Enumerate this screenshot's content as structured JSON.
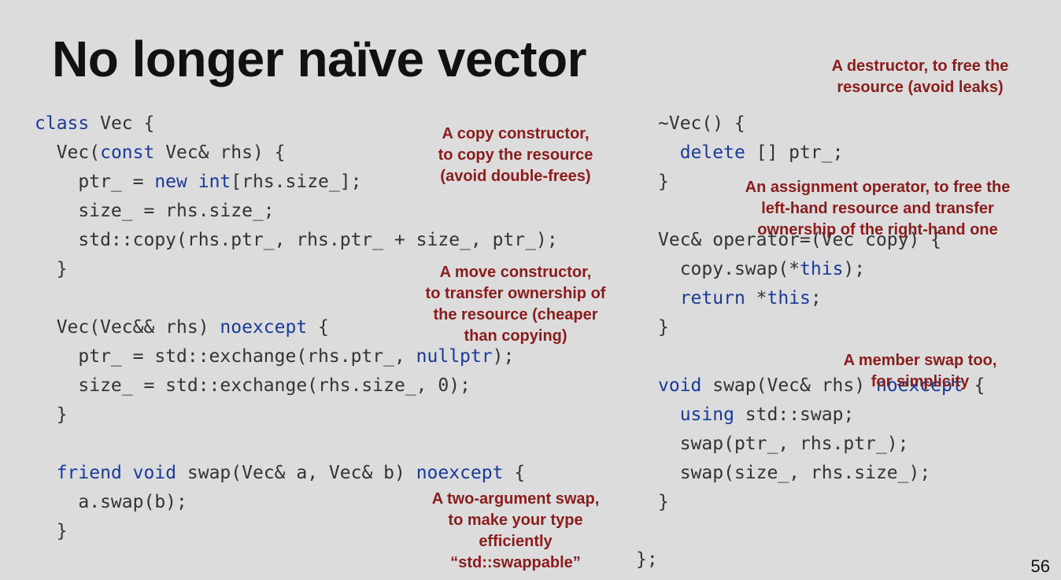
{
  "slide": {
    "title": "No longer naïve vector",
    "page_number": "56"
  },
  "code_left": [
    {
      "indent": 0,
      "tokens": [
        {
          "t": "class",
          "k": true
        },
        {
          "t": " Vec {"
        }
      ]
    },
    {
      "indent": 1,
      "tokens": [
        {
          "t": "Vec("
        },
        {
          "t": "const",
          "k": true
        },
        {
          "t": " Vec& rhs) {"
        }
      ]
    },
    {
      "indent": 2,
      "tokens": [
        {
          "t": "ptr_ = "
        },
        {
          "t": "new",
          "k": true
        },
        {
          "t": " "
        },
        {
          "t": "int",
          "k": true
        },
        {
          "t": "[rhs.size_];"
        }
      ]
    },
    {
      "indent": 2,
      "tokens": [
        {
          "t": "size_ = rhs.size_;"
        }
      ]
    },
    {
      "indent": 2,
      "tokens": [
        {
          "t": "std::copy(rhs.ptr_, rhs.ptr_ + size_, ptr_);"
        }
      ]
    },
    {
      "indent": 1,
      "tokens": [
        {
          "t": "}"
        }
      ]
    },
    {
      "indent": 0,
      "tokens": []
    },
    {
      "indent": 1,
      "tokens": [
        {
          "t": "Vec(Vec&& rhs) "
        },
        {
          "t": "noexcept",
          "k": true
        },
        {
          "t": " {"
        }
      ]
    },
    {
      "indent": 2,
      "tokens": [
        {
          "t": "ptr_ = std::exchange(rhs.ptr_, "
        },
        {
          "t": "nullptr",
          "k": true
        },
        {
          "t": ");"
        }
      ]
    },
    {
      "indent": 2,
      "tokens": [
        {
          "t": "size_ = std::exchange(rhs.size_, 0);"
        }
      ]
    },
    {
      "indent": 1,
      "tokens": [
        {
          "t": "}"
        }
      ]
    },
    {
      "indent": 0,
      "tokens": []
    },
    {
      "indent": 1,
      "tokens": [
        {
          "t": "friend",
          "k": true
        },
        {
          "t": " "
        },
        {
          "t": "void",
          "k": true
        },
        {
          "t": " swap(Vec& a, Vec& b) "
        },
        {
          "t": "noexcept",
          "k": true
        },
        {
          "t": " {"
        }
      ]
    },
    {
      "indent": 2,
      "tokens": [
        {
          "t": "a.swap(b);"
        }
      ]
    },
    {
      "indent": 1,
      "tokens": [
        {
          "t": "}"
        }
      ]
    }
  ],
  "code_right": [
    {
      "indent": 0,
      "tokens": [
        {
          "t": "~Vec() {"
        }
      ]
    },
    {
      "indent": 1,
      "tokens": [
        {
          "t": "delete",
          "k": true
        },
        {
          "t": " [] ptr_;"
        }
      ]
    },
    {
      "indent": 0,
      "tokens": [
        {
          "t": "}"
        }
      ]
    },
    {
      "indent": 0,
      "tokens": []
    },
    {
      "indent": 0,
      "tokens": [
        {
          "t": "Vec& operator=(Vec copy) {"
        }
      ]
    },
    {
      "indent": 1,
      "tokens": [
        {
          "t": "copy.swap(*"
        },
        {
          "t": "this",
          "k": true
        },
        {
          "t": ");"
        }
      ]
    },
    {
      "indent": 1,
      "tokens": [
        {
          "t": "return",
          "k": true
        },
        {
          "t": " *"
        },
        {
          "t": "this",
          "k": true
        },
        {
          "t": ";"
        }
      ]
    },
    {
      "indent": 0,
      "tokens": [
        {
          "t": "}"
        }
      ]
    },
    {
      "indent": 0,
      "tokens": []
    },
    {
      "indent": 0,
      "tokens": [
        {
          "t": "void",
          "k": true
        },
        {
          "t": " swap(Vec& rhs) "
        },
        {
          "t": "noexcept",
          "k": true
        },
        {
          "t": " {"
        }
      ]
    },
    {
      "indent": 1,
      "tokens": [
        {
          "t": "using",
          "k": true
        },
        {
          "t": " std::swap;"
        }
      ]
    },
    {
      "indent": 1,
      "tokens": [
        {
          "t": "swap(ptr_, rhs.ptr_);"
        }
      ]
    },
    {
      "indent": 1,
      "tokens": [
        {
          "t": "swap(size_, rhs.size_);"
        }
      ]
    },
    {
      "indent": 0,
      "tokens": [
        {
          "t": "}"
        }
      ]
    }
  ],
  "code_end": "};",
  "notes": {
    "destructor": [
      "A destructor, to free the",
      "resource (avoid leaks)"
    ],
    "copy_ctor": [
      "A copy constructor,",
      "to copy the resource",
      "(avoid double-frees)"
    ],
    "assignment": [
      "An assignment operator, to free the",
      "left-hand resource and transfer",
      "ownership of the right-hand one"
    ],
    "move_ctor": [
      "A move constructor,",
      "to transfer ownership of",
      "the resource (cheaper",
      "than copying)"
    ],
    "member_swap": [
      "A member swap too,",
      "for simplicity"
    ],
    "two_arg_swap": [
      "A two-argument swap,",
      "to make your type",
      "efficiently",
      "“std::swappable”"
    ]
  },
  "colors": {
    "background": "#dcdcdc",
    "title": "#111111",
    "code": "#333333",
    "keyword": "#1a3a9a",
    "note": "#8b1c1c"
  }
}
